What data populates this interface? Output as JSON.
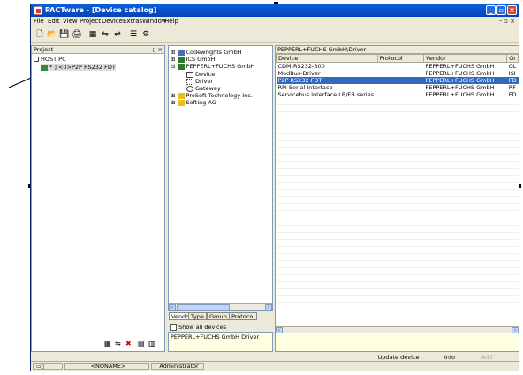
{
  "window": {
    "title": "PACTware - [Device catalog]"
  },
  "menu": {
    "items": [
      "File",
      "Edit",
      "View",
      "Project",
      "Device",
      "Extras",
      "Window",
      "Help"
    ],
    "mdi": "- ▫ ×"
  },
  "project": {
    "title": "Project",
    "pin": "▯ ×",
    "host": "HOST PC",
    "device": "* ] <0>P2P RS232 FDT"
  },
  "catalog_tree": {
    "items": [
      "Codewrights GmbH",
      "ICS GmbH",
      "PEPPERL+FUCHS GmbH",
      "Device",
      "Driver",
      "Gateway",
      "ProSoft Technology Inc.",
      "Softing AG"
    ]
  },
  "tabs": [
    "Vendor",
    "Type",
    "Group",
    "Protocol"
  ],
  "show_all": "Show all devices",
  "selected_info": "PEPPERL+FUCHS GmbH Driver",
  "device_list": {
    "path": "PEPPERL+FUCHS GmbH\\Driver",
    "columns": [
      "Device",
      "Protocol",
      "Vendor",
      "Gr"
    ],
    "rows": [
      [
        "CDM-RS232-300",
        "",
        "PEPPERL+FUCHS GmbH",
        "GL"
      ],
      [
        "ModBus-Driver",
        "",
        "PEPPERL+FUCHS GmbH",
        "ISI"
      ],
      [
        "P2P RS232 FDT",
        "",
        "PEPPERL+FUCHS GmbH",
        "FD"
      ],
      [
        "RPI Serial Interface",
        "",
        "PEPPERL+FUCHS GmbH",
        "RF"
      ],
      [
        "Servicebus interface LB/FB series",
        "",
        "PEPPERL+FUCHS GmbH",
        "FD"
      ]
    ],
    "selected_index": 2
  },
  "buttons": {
    "update": "Update device catalog",
    "info": "Info",
    "add": "Add"
  },
  "status": {
    "doc": "<NONAME>",
    "user": "Administrator"
  },
  "colors": {
    "accent": "#316ac5",
    "title": "#0a5fd8"
  }
}
